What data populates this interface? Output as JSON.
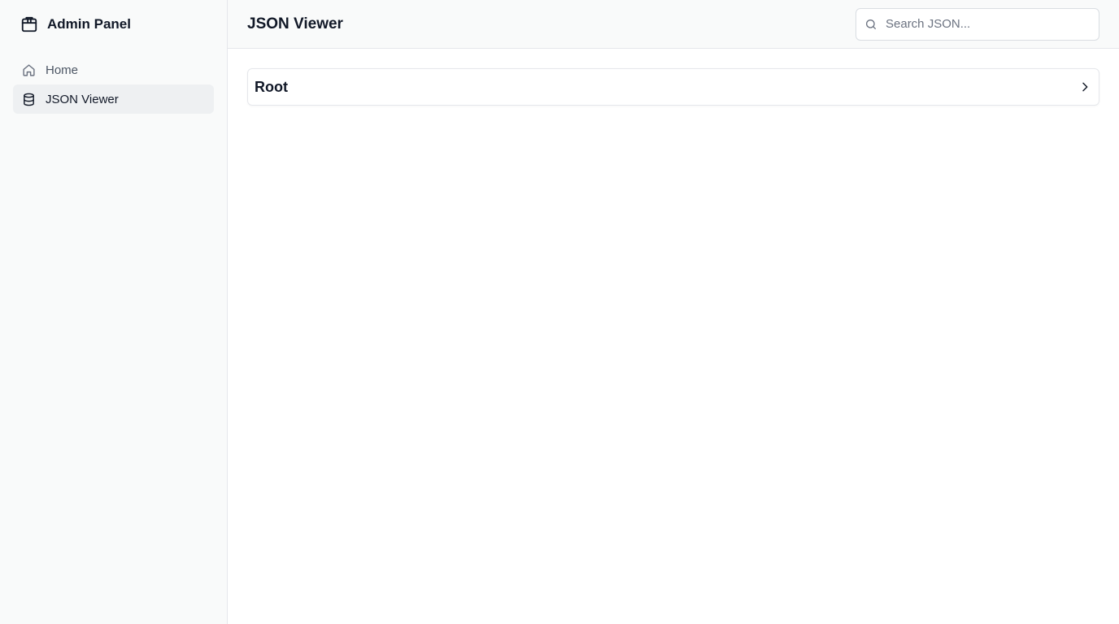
{
  "app": {
    "title": "Admin Panel",
    "brand_icon": "package-icon"
  },
  "sidebar": {
    "items": [
      {
        "label": "Home",
        "icon": "home-icon",
        "active": false
      },
      {
        "label": "JSON Viewer",
        "icon": "database-icon",
        "active": true
      }
    ]
  },
  "header": {
    "title": "JSON Viewer",
    "search": {
      "placeholder": "Search JSON...",
      "value": ""
    }
  },
  "tree": {
    "root_label": "Root",
    "expanded": false
  },
  "colors": {
    "sidebar_bg": "#f9fafa",
    "active_item_bg": "#eef0f2",
    "border": "#e5e7eb",
    "text": "#111827",
    "muted_text": "#4b5563"
  }
}
